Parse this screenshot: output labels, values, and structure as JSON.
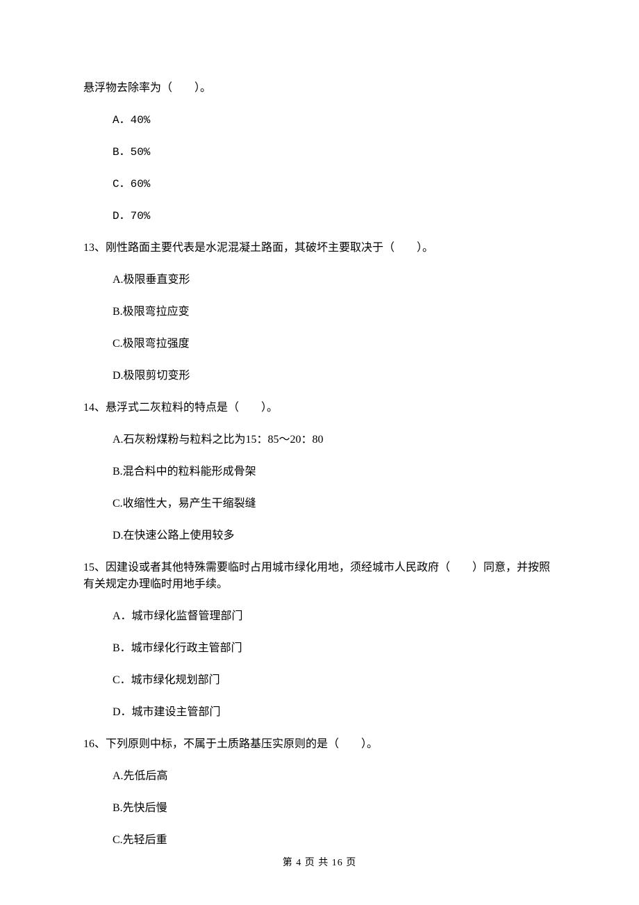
{
  "q12": {
    "stem_cont": "悬浮物去除率为（　　）。",
    "opts": {
      "a": "A．40%",
      "b": "B．50%",
      "c": "C．60%",
      "d": "D．70%"
    }
  },
  "q13": {
    "stem": "13、刚性路面主要代表是水泥混凝土路面，其破坏主要取决于（　　）。",
    "opts": {
      "a": "A.极限垂直变形",
      "b": "B.极限弯拉应变",
      "c": "C.极限弯拉强度",
      "d": "D.极限剪切变形"
    }
  },
  "q14": {
    "stem": "14、悬浮式二灰粒料的特点是（　　）。",
    "opts": {
      "a": "A.石灰粉煤粉与粒料之比为15：85～20：80",
      "b": "B.混合料中的粒料能形成骨架",
      "c": "C.收缩性大，易产生干缩裂缝",
      "d": "D.在快速公路上使用较多"
    }
  },
  "q15": {
    "stem": "15、因建设或者其他特殊需要临时占用城市绿化用地，须经城市人民政府（　　）同意，并按照有关规定办理临时用地手续。",
    "opts": {
      "a": "A．城市绿化监督管理部门",
      "b": "B．城市绿化行政主管部门",
      "c": "C．城市绿化规划部门",
      "d": "D．城市建设主管部门"
    }
  },
  "q16": {
    "stem": "16、下列原则中标，不属于土质路基压实原则的是（　　）。",
    "opts": {
      "a": "A.先低后高",
      "b": "B.先快后慢",
      "c": "C.先轻后重"
    }
  },
  "footer": "第 4 页 共 16 页"
}
